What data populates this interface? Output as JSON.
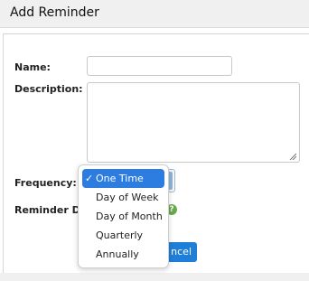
{
  "header": {
    "title": "Add Reminder"
  },
  "form": {
    "name_label": "Name:",
    "name_value": "",
    "description_label": "Description:",
    "description_value": "",
    "frequency_label": "Frequency:",
    "reminder_date_label": "Reminder Date"
  },
  "frequency_dropdown": {
    "selected": "One Time",
    "check_mark": "✓",
    "options": [
      "One Time",
      "Day of Week",
      "Day of Month",
      "Quarterly",
      "Annually"
    ]
  },
  "help": {
    "glyph": "?"
  },
  "buttons": {
    "cancel_visible_text": "ncel"
  },
  "colors": {
    "accent": "#2d7de0",
    "cancel_button": "#1f7ed8",
    "help_icon": "#6aa84f"
  }
}
